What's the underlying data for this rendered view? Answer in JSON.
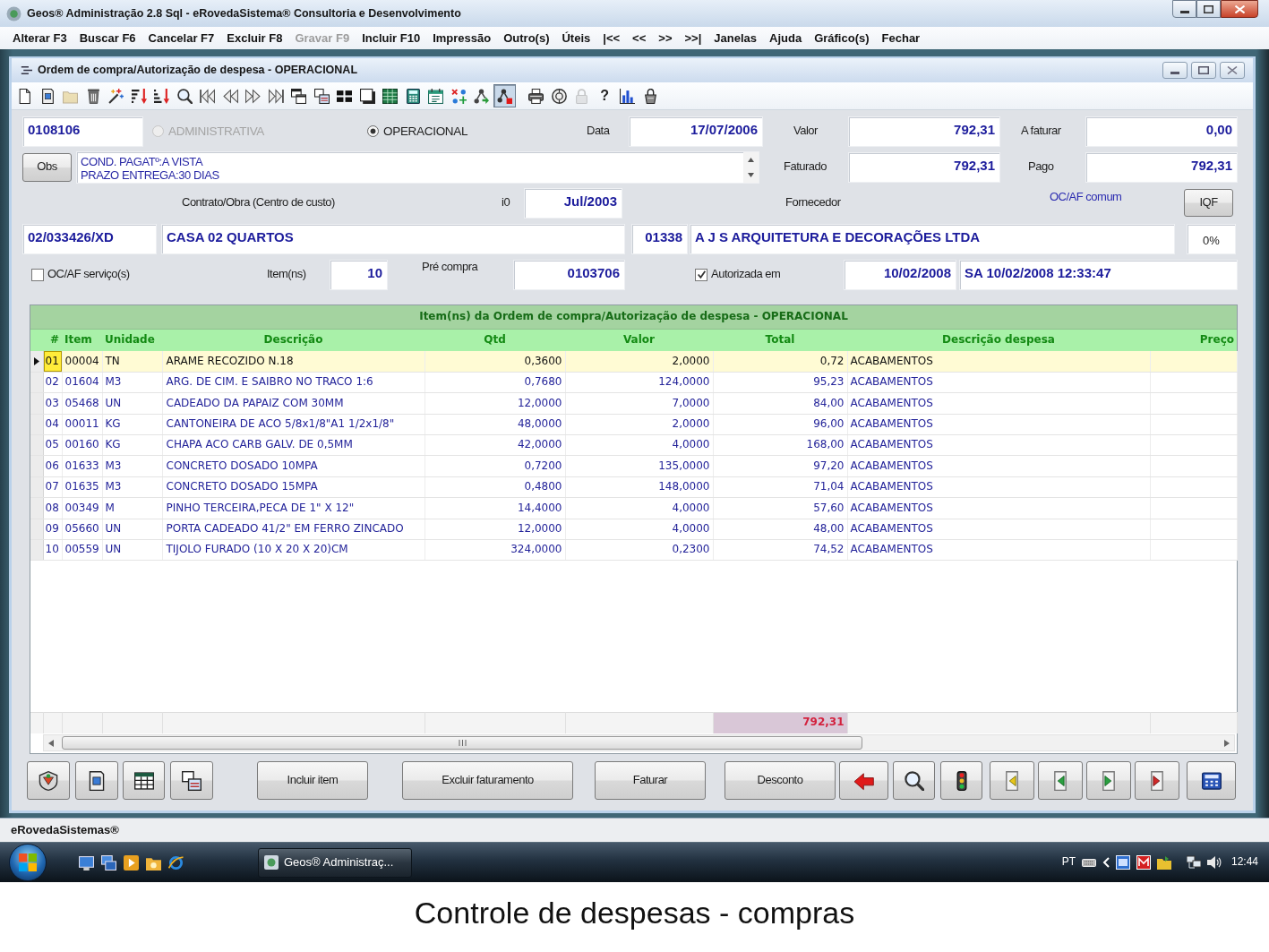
{
  "window": {
    "title": "Geos® Administração 2.8 Sql - eRovedaSistema® Consultoria e Desenvolvimento"
  },
  "menu": [
    {
      "label": "Alterar F3",
      "disabled": false
    },
    {
      "label": "Buscar F6",
      "disabled": false
    },
    {
      "label": "Cancelar F7",
      "disabled": false
    },
    {
      "label": "Excluir F8",
      "disabled": false
    },
    {
      "label": "Gravar F9",
      "disabled": true
    },
    {
      "label": "Incluir F10",
      "disabled": false
    },
    {
      "label": "Impressão",
      "disabled": false
    },
    {
      "label": "Outro(s)",
      "disabled": false
    },
    {
      "label": "Úteis",
      "disabled": false
    },
    {
      "label": "|<<",
      "disabled": false
    },
    {
      "label": "<<",
      "disabled": false
    },
    {
      "label": ">>",
      "disabled": false
    },
    {
      "label": ">>|",
      "disabled": false
    },
    {
      "label": "Janelas",
      "disabled": false
    },
    {
      "label": "Ajuda",
      "disabled": false
    },
    {
      "label": "Gráfico(s)",
      "disabled": false
    },
    {
      "label": "Fechar",
      "disabled": false
    }
  ],
  "child_window": {
    "title": "Ordem de compra/Autorização de despesa - OPERACIONAL"
  },
  "toolbar": [
    {
      "disabled": false,
      "pressed": false
    },
    {
      "disabled": false,
      "pressed": false
    },
    {
      "disabled": true,
      "pressed": false
    },
    {
      "disabled": false,
      "pressed": false
    },
    {
      "disabled": false,
      "pressed": false
    },
    {
      "disabled": false,
      "pressed": false
    },
    {
      "disabled": false,
      "pressed": false
    },
    {
      "disabled": false,
      "pressed": false
    },
    {
      "disabled": false,
      "pressed": false
    },
    {
      "disabled": false,
      "pressed": false
    },
    {
      "disabled": false,
      "pressed": false
    },
    {
      "disabled": false,
      "pressed": false
    },
    {
      "disabled": false,
      "pressed": false
    },
    {
      "disabled": false,
      "pressed": false
    },
    {
      "disabled": false,
      "pressed": false
    },
    {
      "disabled": false,
      "pressed": false
    },
    {
      "disabled": false,
      "pressed": false
    },
    {
      "disabled": false,
      "pressed": false
    },
    {
      "disabled": false,
      "pressed": false
    },
    {
      "disabled": false,
      "pressed": false
    },
    {
      "disabled": false,
      "pressed": false
    },
    {
      "disabled": false,
      "pressed": true
    },
    {
      "disabled": false,
      "pressed": false
    },
    {
      "disabled": false,
      "pressed": false
    },
    {
      "disabled": true,
      "pressed": false
    },
    {
      "glyph": "?",
      "disabled": false,
      "pressed": false
    },
    {
      "disabled": false,
      "pressed": false
    },
    {
      "disabled": false,
      "pressed": false
    }
  ],
  "form": {
    "order_number": "0108106",
    "type_options": [
      {
        "label": "ADMINISTRATIVA",
        "selected": false,
        "disabled": true
      },
      {
        "label": "OPERACIONAL",
        "selected": true,
        "disabled": false
      }
    ],
    "date": {
      "label": "Data",
      "value": "17/07/2006"
    },
    "valor": {
      "label": "Valor",
      "value": "792,31"
    },
    "a_faturar": {
      "label": "A faturar",
      "value": "0,00"
    },
    "obs_button": "Obs",
    "obs_lines": [
      "COND. PAGATº:A VISTA",
      "PRAZO ENTREGA:30 DIAS"
    ],
    "faturado": {
      "label": "Faturado",
      "value": "792,31"
    },
    "pago": {
      "label": "Pago",
      "value": "792,31"
    },
    "contract_label": "Contrato/Obra (Centro de custo)",
    "i0_label": "i0",
    "period": "Jul/2003",
    "supplier_label": "Fornecedor",
    "common_label": "OC/AF comum",
    "iqf_button": "IQF",
    "contract_code": "02/033426/XD",
    "contract_name": "CASA 02 QUARTOS",
    "supplier_code": "01338",
    "supplier_name": "A J S ARQUITETURA E DECORAÇÕES LTDA",
    "iqf_value": "0%",
    "services": {
      "label": "OC/AF serviço(s)",
      "checked": false
    },
    "items_label": "Item(ns)",
    "items_count": "10",
    "pre_purchase": {
      "label": "Pré compra",
      "value": "0103706"
    },
    "authorized": {
      "label": "Autorizada em",
      "checked": true
    },
    "authorized_date": "10/02/2008",
    "authorized_stamp": "SA 10/02/2008 12:33:47"
  },
  "grid": {
    "title": "Item(ns) da Ordem de compra/Autorização de despesa - OPERACIONAL",
    "columns": [
      "#",
      "Item",
      "Unidade",
      "Descrição",
      "Qtd",
      "Valor",
      "Total",
      "Descrição despesa",
      "Preço"
    ],
    "rows": [
      {
        "number": "01",
        "item": "00004",
        "unit": "TN",
        "description": "ARAME RECOZIDO N.18",
        "qty": "0,3600",
        "price": "2,0000",
        "total": "0,72",
        "expense": "ACABAMENTOS",
        "selected": true
      },
      {
        "number": "02",
        "item": "01604",
        "unit": "M3",
        "description": "ARG. DE CIM. E SAIBRO NO TRACO 1:6",
        "qty": "0,7680",
        "price": "124,0000",
        "total": "95,23",
        "expense": "ACABAMENTOS",
        "selected": false
      },
      {
        "number": "03",
        "item": "05468",
        "unit": "UN",
        "description": "CADEADO DA PAPAIZ COM 30MM",
        "qty": "12,0000",
        "price": "7,0000",
        "total": "84,00",
        "expense": "ACABAMENTOS",
        "selected": false
      },
      {
        "number": "04",
        "item": "00011",
        "unit": "KG",
        "description": "CANTONEIRA DE ACO 5/8x1/8\"A1 1/2x1/8\"",
        "qty": "48,0000",
        "price": "2,0000",
        "total": "96,00",
        "expense": "ACABAMENTOS",
        "selected": false
      },
      {
        "number": "05",
        "item": "00160",
        "unit": "KG",
        "description": "CHAPA ACO CARB GALV. DE 0,5MM",
        "qty": "42,0000",
        "price": "4,0000",
        "total": "168,00",
        "expense": "ACABAMENTOS",
        "selected": false
      },
      {
        "number": "06",
        "item": "01633",
        "unit": "M3",
        "description": "CONCRETO DOSADO 10MPA",
        "qty": "0,7200",
        "price": "135,0000",
        "total": "97,20",
        "expense": "ACABAMENTOS",
        "selected": false
      },
      {
        "number": "07",
        "item": "01635",
        "unit": "M3",
        "description": "CONCRETO DOSADO 15MPA",
        "qty": "0,4800",
        "price": "148,0000",
        "total": "71,04",
        "expense": "ACABAMENTOS",
        "selected": false
      },
      {
        "number": "08",
        "item": "00349",
        "unit": "M",
        "description": "PINHO TERCEIRA,PECA DE 1\" X 12\"",
        "qty": "14,4000",
        "price": "4,0000",
        "total": "57,60",
        "expense": "ACABAMENTOS",
        "selected": false
      },
      {
        "number": "09",
        "item": "05660",
        "unit": "UN",
        "description": "PORTA CADEADO 41/2\" EM FERRO ZINCADO",
        "qty": "12,0000",
        "price": "4,0000",
        "total": "48,00",
        "expense": "ACABAMENTOS",
        "selected": false
      },
      {
        "number": "10",
        "item": "00559",
        "unit": "UN",
        "description": "TIJOLO FURADO (10 X 20 X 20)CM",
        "qty": "324,0000",
        "price": "0,2300",
        "total": "74,52",
        "expense": "ACABAMENTOS",
        "selected": false
      }
    ],
    "footer_total": "792,31"
  },
  "buttons": [
    {
      "kind": "icon"
    },
    {
      "kind": "icon"
    },
    {
      "kind": "icon"
    },
    {
      "kind": "icon"
    },
    {
      "kind": "text",
      "label": "Incluir item"
    },
    {
      "kind": "text",
      "label": "Excluir faturamento"
    },
    {
      "kind": "text",
      "label": "Faturar"
    },
    {
      "kind": "text",
      "label": "Desconto"
    },
    {
      "kind": "icon"
    },
    {
      "kind": "icon"
    },
    {
      "kind": "icon"
    },
    {
      "kind": "icon"
    },
    {
      "kind": "icon"
    },
    {
      "kind": "icon"
    },
    {
      "kind": "icon"
    },
    {
      "kind": "icon"
    }
  ],
  "status_bar": "eRovedaSistemas®",
  "taskbar": {
    "task": "Geos® Administraç...",
    "language": "PT",
    "clock": "12:44"
  },
  "caption": "Controle de despesas - compras"
}
